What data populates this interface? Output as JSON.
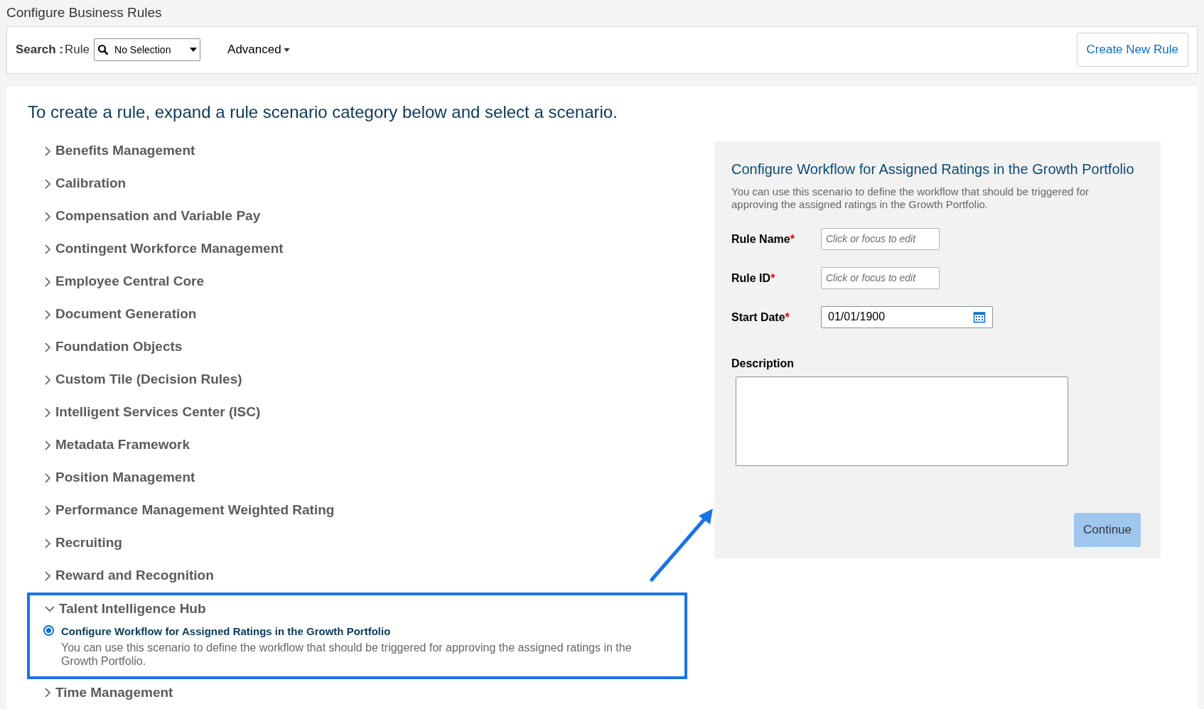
{
  "page_title": "Configure Business Rules",
  "toolbar": {
    "search_label": "Search :",
    "search_field_label": "Rule",
    "search_select": "No Selection",
    "advanced": "Advanced",
    "create_button": "Create New Rule"
  },
  "intro": "To create a rule, expand a rule scenario category below and select a scenario.",
  "categories": [
    {
      "label": "Benefits Management",
      "expanded": false
    },
    {
      "label": "Calibration",
      "expanded": false
    },
    {
      "label": "Compensation and Variable Pay",
      "expanded": false
    },
    {
      "label": "Contingent Workforce Management",
      "expanded": false
    },
    {
      "label": "Employee Central Core",
      "expanded": false
    },
    {
      "label": "Document Generation",
      "expanded": false
    },
    {
      "label": "Foundation Objects",
      "expanded": false
    },
    {
      "label": "Custom Tile (Decision Rules)",
      "expanded": false
    },
    {
      "label": "Intelligent Services Center (ISC)",
      "expanded": false
    },
    {
      "label": "Metadata Framework",
      "expanded": false
    },
    {
      "label": "Position Management",
      "expanded": false
    },
    {
      "label": "Performance Management Weighted Rating",
      "expanded": false
    },
    {
      "label": "Recruiting",
      "expanded": false
    },
    {
      "label": "Reward and Recognition",
      "expanded": false
    },
    {
      "label": "Talent Intelligence Hub",
      "expanded": true,
      "scenarios": [
        {
          "title": "Configure Workflow for Assigned Ratings in the Growth Portfolio",
          "description": "You can use this scenario to define the workflow that should be triggered for approving the assigned ratings in the Growth Portfolio.",
          "selected": true
        }
      ]
    },
    {
      "label": "Time Management",
      "expanded": false
    }
  ],
  "detail": {
    "title": "Configure Workflow for Assigned Ratings in the Growth Portfolio",
    "description": "You can use this scenario to define the workflow that should be triggered for approving the assigned ratings in the Growth Portfolio.",
    "fields": [
      {
        "kind": "text",
        "label": "Rule Name",
        "required_mark": "*",
        "placeholder": "Click or focus to edit"
      },
      {
        "kind": "text",
        "label": "Rule ID",
        "required_mark": "*",
        "placeholder": "Click or focus to edit"
      },
      {
        "kind": "date",
        "label": "Start Date",
        "required_mark": "*",
        "value": "01/01/1900"
      }
    ],
    "description_label": "Description",
    "continue_button": "Continue"
  }
}
